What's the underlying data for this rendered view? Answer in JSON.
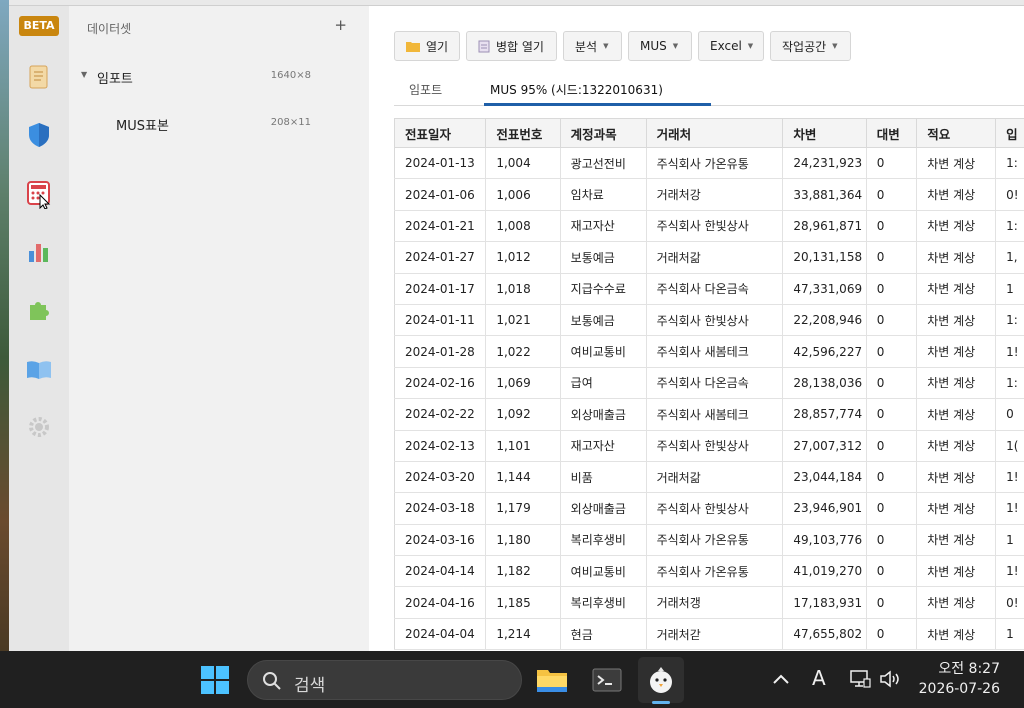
{
  "sidebar": {
    "badge": "BETA",
    "icons": [
      "scroll-icon",
      "shield-icon",
      "calculator-icon",
      "bar-chart-icon",
      "puzzle-icon",
      "book-icon",
      "gear-icon"
    ]
  },
  "dataset_panel": {
    "title": "데이터셋",
    "add_label": "+",
    "items": [
      {
        "name": "임포트",
        "dims": "1640×8"
      },
      {
        "name": "MUS표본",
        "dims": "208×11"
      }
    ]
  },
  "toolbar": {
    "open_label": "열기",
    "merge_open_label": "병합 열기",
    "analysis_label": "분석",
    "mus_label": "MUS",
    "excel_label": "Excel",
    "workspace_label": "작업공간"
  },
  "tabs": [
    {
      "label": "임포트"
    },
    {
      "label": "MUS 95% (시드:1322010631)"
    }
  ],
  "table": {
    "headers": [
      "전표일자",
      "전표번호",
      "계정과목",
      "거래처",
      "차변",
      "대변",
      "적요",
      "입"
    ],
    "rows": [
      [
        "2024-01-13",
        "1,004",
        "광고선전비",
        "주식회사 가온유통",
        "24,231,923",
        "0",
        "차변 계상",
        "1:"
      ],
      [
        "2024-01-06",
        "1,006",
        "임차료",
        "거래처강",
        "33,881,364",
        "0",
        "차변 계상",
        "0!"
      ],
      [
        "2024-01-21",
        "1,008",
        "재고자산",
        "주식회사 한빛상사",
        "28,961,871",
        "0",
        "차변 계상",
        "1:"
      ],
      [
        "2024-01-27",
        "1,012",
        "보통예금",
        "거래처갊",
        "20,131,158",
        "0",
        "차변 계상",
        "1,"
      ],
      [
        "2024-01-17",
        "1,018",
        "지급수수료",
        "주식회사 다온금속",
        "47,331,069",
        "0",
        "차변 계상",
        "1"
      ],
      [
        "2024-01-11",
        "1,021",
        "보통예금",
        "주식회사 한빛상사",
        "22,208,946",
        "0",
        "차변 계상",
        "1:"
      ],
      [
        "2024-01-28",
        "1,022",
        "여비교통비",
        "주식회사 새봄테크",
        "42,596,227",
        "0",
        "차변 계상",
        "1!"
      ],
      [
        "2024-02-16",
        "1,069",
        "급여",
        "주식회사 다온금속",
        "28,138,036",
        "0",
        "차변 계상",
        "1:"
      ],
      [
        "2024-02-22",
        "1,092",
        "외상매출금",
        "주식회사 새봄테크",
        "28,857,774",
        "0",
        "차변 계상",
        "0"
      ],
      [
        "2024-02-13",
        "1,101",
        "재고자산",
        "주식회사 한빛상사",
        "27,007,312",
        "0",
        "차변 계상",
        "1("
      ],
      [
        "2024-03-20",
        "1,144",
        "비품",
        "거래처갊",
        "23,044,184",
        "0",
        "차변 계상",
        "1!"
      ],
      [
        "2024-03-18",
        "1,179",
        "외상매출금",
        "주식회사 한빛상사",
        "23,946,901",
        "0",
        "차변 계상",
        "1!"
      ],
      [
        "2024-03-16",
        "1,180",
        "복리후생비",
        "주식회사 가온유통",
        "49,103,776",
        "0",
        "차변 계상",
        "1"
      ],
      [
        "2024-04-14",
        "1,182",
        "여비교통비",
        "주식회사 가온유통",
        "41,019,270",
        "0",
        "차변 계상",
        "1!"
      ],
      [
        "2024-04-16",
        "1,185",
        "복리후생비",
        "거래처갱",
        "17,183,931",
        "0",
        "차변 계상",
        "0!"
      ],
      [
        "2024-04-04",
        "1,214",
        "현금",
        "거래처갇",
        "47,655,802",
        "0",
        "차변 계상",
        "1"
      ]
    ]
  },
  "taskbar": {
    "search_placeholder": "검색",
    "ime_label": "A",
    "clock_time": "오전 8:27",
    "clock_date": "2026-07-26"
  },
  "colors": {
    "accent": "#1f5fa8",
    "beta_badge": "#c9860f",
    "taskbar": "#202020"
  }
}
